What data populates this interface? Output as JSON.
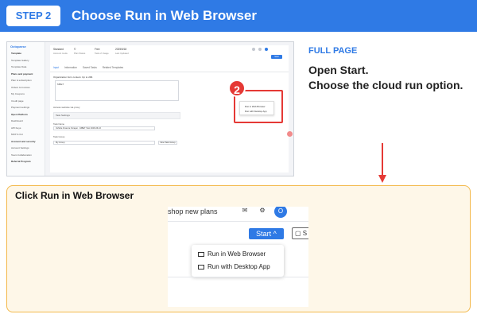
{
  "header": {
    "step_label": "STEP 2",
    "title": "Choose Run in Web Browser"
  },
  "thumbnail": {
    "logo": "Octoparse",
    "sidebar": [
      {
        "label": "Template",
        "head": true
      },
      {
        "label": "Template Gallery",
        "head": false
      },
      {
        "label": "Template Data",
        "head": false
      },
      {
        "label": "Plans and payment",
        "head": true
      },
      {
        "label": "Plan & subscription",
        "head": false
      },
      {
        "label": "Orders & invoices",
        "head": false
      },
      {
        "label": "My Coupons",
        "head": false
      },
      {
        "label": "Credit page",
        "head": false
      },
      {
        "label": "Payment settings",
        "head": false
      },
      {
        "label": "Open Platform",
        "head": true
      },
      {
        "label": "Dashboard",
        "head": false
      },
      {
        "label": "API Keys",
        "head": false
      },
      {
        "label": "MCP & CLI",
        "head": false
      },
      {
        "label": "Account and security",
        "head": true
      },
      {
        "label": "Account Settings",
        "head": false
      },
      {
        "label": "Team Collaboration",
        "head": false
      },
      {
        "label": "Referral Program",
        "head": true
      }
    ],
    "meta": [
      {
        "value": "Standard",
        "label": "Account mode"
      },
      {
        "value": "©",
        "label": "Plan Status"
      },
      {
        "value": "Free",
        "label": "Task of Usage"
      },
      {
        "value": "2025/5/18",
        "label": "Last Updated"
      }
    ],
    "tabs": [
      "Input",
      "Information",
      "Saved Tasks",
      "Related Templates"
    ],
    "url_label": "Organization form content. Up to 200.",
    "url_value": "MBET",
    "check_label": "Access website via proxy",
    "panel_label": "Task Settings",
    "task_name_label": "Task Name",
    "task_name_value": "Vehicle Finance Scraper - MBET Test 2026-06-16",
    "task_group_label": "Task Group",
    "task_group_value": "My Group",
    "new_group_btn": "New Task Group",
    "start_btn": "Start",
    "menu": [
      "Run in Web Browser",
      "Run with Desktop App"
    ],
    "step_number": "2",
    "help": "?"
  },
  "description": {
    "section_label": "FULL PAGE",
    "line1": "Open Start.",
    "line2": "Choose the cloud run option."
  },
  "callout": {
    "title": "Click Run in Web Browser",
    "zoom": {
      "shop_text": "shop new plans",
      "avatar_text": "O",
      "start_label": "Start ^",
      "s_btn": "S",
      "menu_items": [
        "Run in Web Browser",
        "Run with Desktop App"
      ]
    }
  },
  "colors": {
    "primary": "#2f7ae5",
    "highlight": "#e53935",
    "callout_bg": "#fef7e8",
    "callout_border": "#f3b94b"
  }
}
